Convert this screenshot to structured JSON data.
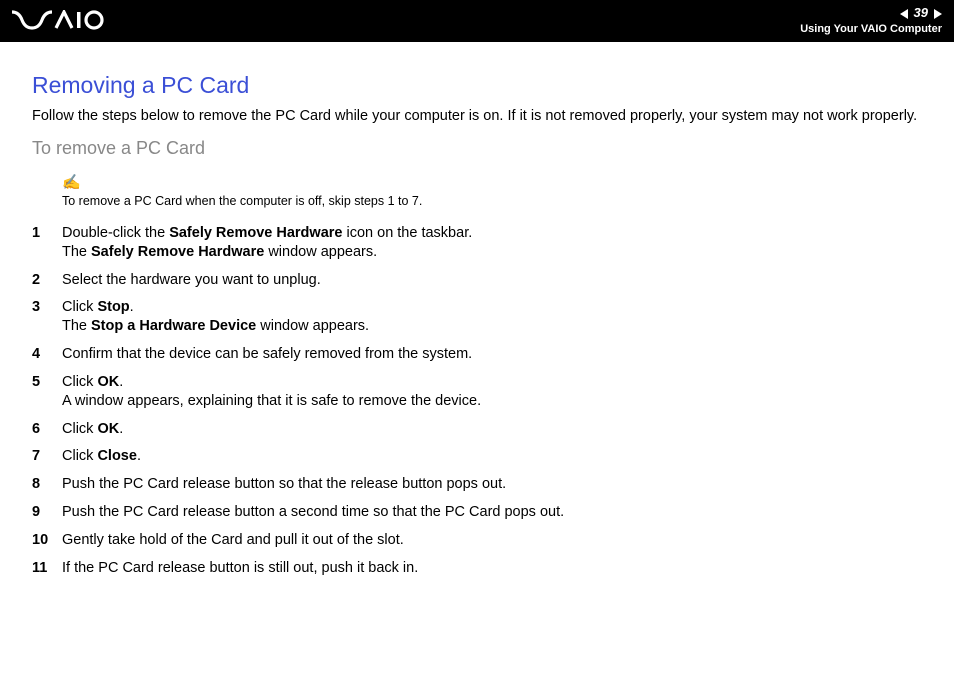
{
  "header": {
    "logo_text": "VAIO",
    "page_number": "39",
    "section": "Using Your VAIO Computer"
  },
  "title": "Removing a PC Card",
  "intro": "Follow the steps below to remove the PC Card while your computer is on. If it is not removed properly, your system may not work properly.",
  "subtitle": "To remove a PC Card",
  "note": {
    "icon": "✍",
    "text": "To remove a PC Card when the computer is off, skip steps 1 to 7."
  },
  "steps": [
    {
      "num": "1",
      "line1_pre": "Double-click the ",
      "line1_bold": "Safely Remove Hardware",
      "line1_post": " icon on the taskbar.",
      "line2_pre": "The ",
      "line2_bold": "Safely Remove Hardware",
      "line2_post": " window appears."
    },
    {
      "num": "2",
      "line1_pre": "Select the hardware you want to unplug.",
      "line1_bold": "",
      "line1_post": ""
    },
    {
      "num": "3",
      "line1_pre": "Click ",
      "line1_bold": "Stop",
      "line1_post": ".",
      "line2_pre": "The ",
      "line2_bold": "Stop a Hardware Device",
      "line2_post": " window appears."
    },
    {
      "num": "4",
      "line1_pre": "Confirm that the device can be safely removed from the system.",
      "line1_bold": "",
      "line1_post": ""
    },
    {
      "num": "5",
      "line1_pre": "Click ",
      "line1_bold": "OK",
      "line1_post": ".",
      "line2_pre": "A window appears, explaining that it is safe to remove the device.",
      "line2_bold": "",
      "line2_post": ""
    },
    {
      "num": "6",
      "line1_pre": "Click ",
      "line1_bold": "OK",
      "line1_post": "."
    },
    {
      "num": "7",
      "line1_pre": "Click ",
      "line1_bold": "Close",
      "line1_post": "."
    },
    {
      "num": "8",
      "line1_pre": "Push the PC Card release button so that the release button pops out.",
      "line1_bold": "",
      "line1_post": ""
    },
    {
      "num": "9",
      "line1_pre": "Push the PC Card release button a second time so that the PC Card pops out.",
      "line1_bold": "",
      "line1_post": ""
    },
    {
      "num": "10",
      "line1_pre": "Gently take hold of the Card and pull it out of the slot.",
      "line1_bold": "",
      "line1_post": ""
    },
    {
      "num": "11",
      "line1_pre": "If the PC Card release button is still out, push it back in.",
      "line1_bold": "",
      "line1_post": ""
    }
  ]
}
